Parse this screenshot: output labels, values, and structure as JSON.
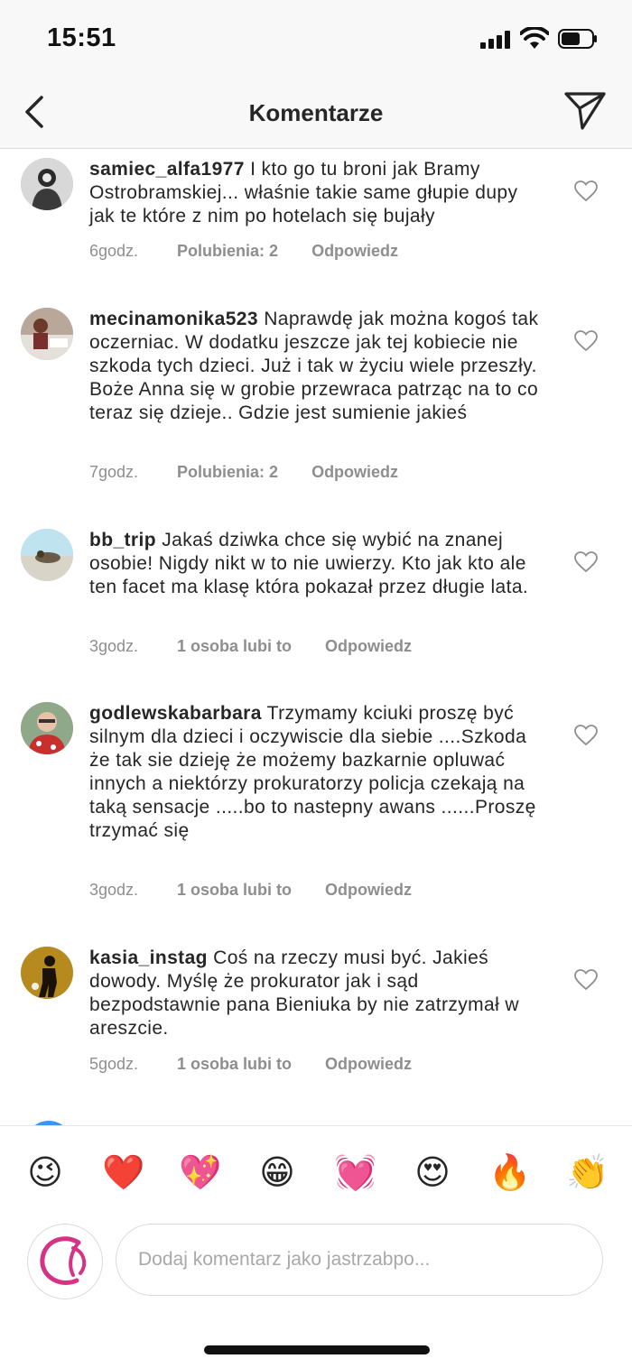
{
  "status": {
    "time": "15:51"
  },
  "header": {
    "title": "Komentarze"
  },
  "comments": [
    {
      "username": "samiec_alfa1977",
      "text": "I kto go tu broni jak Bramy Ostrobramskiej... właśnie takie same głupie dupy jak te które z nim po hotelach się bujały",
      "time": "6godz.",
      "likes": "Polubienia: 2",
      "reply": "Odpowiedz"
    },
    {
      "username": "mecinamonika523",
      "text": "Naprawdę jak można kogoś tak oczerniac. W dodatku jeszcze jak tej kobiecie nie szkoda tych dzieci. Już i tak w życiu wiele przeszły. Boże Anna się w grobie przewraca patrząc na to co teraz się dzieje.. Gdzie jest sumienie jakieś",
      "time": "7godz.",
      "likes": "Polubienia: 2",
      "reply": "Odpowiedz"
    },
    {
      "username": "bb_trip",
      "text": "Jakaś dziwka chce się wybić na znanej osobie! Nigdy nikt w to nie uwierzy. Kto jak kto ale ten facet ma klasę która pokazał przez długie lata.",
      "time": "3godz.",
      "likes": "1 osoba lubi to",
      "reply": "Odpowiedz"
    },
    {
      "username": "godlewskabarbara",
      "text": "Trzymamy kciuki proszę być silnym dla dzieci i oczywiscie dla siebie ....Szkoda że tak sie dzieję że możemy bazkarnie opluwać innych a niektórzy prokuratorzy policja czekają na taką sensacje .....bo to nastepny awans ......Proszę trzymać się",
      "time": "3godz.",
      "likes": "1 osoba lubi to",
      "reply": "Odpowiedz"
    },
    {
      "username": "kasia_instag",
      "text": "Coś na rzeczy musi być. Jakieś dowody. Myślę że prokurator jak i sąd bezpodstawnie pana Bieniuka  by nie zatrzymał w areszcie.",
      "time": "5godz.",
      "likes": "1 osoba lubi to",
      "reply": "Odpowiedz"
    }
  ],
  "emoji_bar": [
    "😉",
    "❤️",
    "💖",
    "😁",
    "💓",
    "😍",
    "🔥",
    "👏"
  ],
  "composer": {
    "placeholder": "Dodaj komentarz jako jastrzabpo..."
  },
  "colors": {
    "text": "#262626",
    "meta": "#8e8e8e",
    "divider": "#dbdbdb",
    "bar_bg": "#f8f8f8"
  }
}
